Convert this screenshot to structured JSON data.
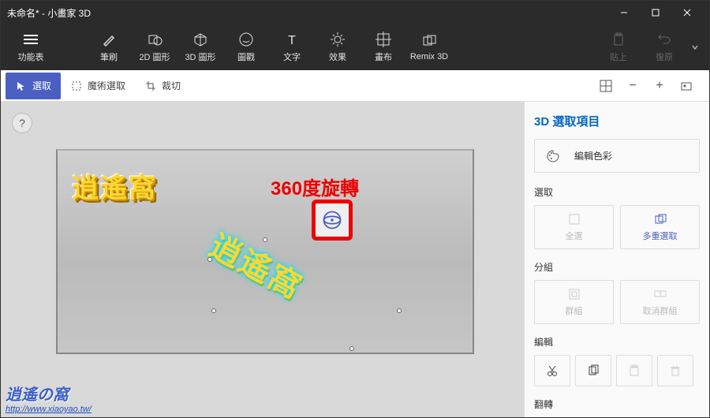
{
  "window": {
    "title": "未命名* - 小畫家 3D"
  },
  "ribbon": {
    "menu": "功能表",
    "items": [
      {
        "label": "筆刷",
        "icon": "brush"
      },
      {
        "label": "2D 圖形",
        "icon": "shape2d"
      },
      {
        "label": "3D 圖形",
        "icon": "shape3d"
      },
      {
        "label": "圖戳",
        "icon": "sticker"
      },
      {
        "label": "文字",
        "icon": "text"
      },
      {
        "label": "效果",
        "icon": "effects"
      },
      {
        "label": "畫布",
        "icon": "canvas"
      },
      {
        "label": "Remix 3D",
        "icon": "remix"
      }
    ],
    "paste": "貼上",
    "undo": "復原"
  },
  "subbar": {
    "select": "選取",
    "magic": "魔術選取",
    "crop": "裁切"
  },
  "canvas": {
    "text_a": "逍遙窩",
    "annotation": "360度旋轉",
    "text_b": "逍遙窩"
  },
  "watermark": {
    "line1": "逍遙の窩",
    "line2": "http://www.xiaoyao.tw/"
  },
  "help": "?",
  "sidepanel": {
    "title": "3D 選取項目",
    "edit_color": "編輯色彩",
    "sections": {
      "select": "選取",
      "group": "分組",
      "edit": "編輯",
      "flip": "翻轉"
    },
    "tiles": {
      "select_all": "全選",
      "multi_select": "多重選取",
      "group": "群組",
      "ungroup": "取消群組"
    }
  }
}
